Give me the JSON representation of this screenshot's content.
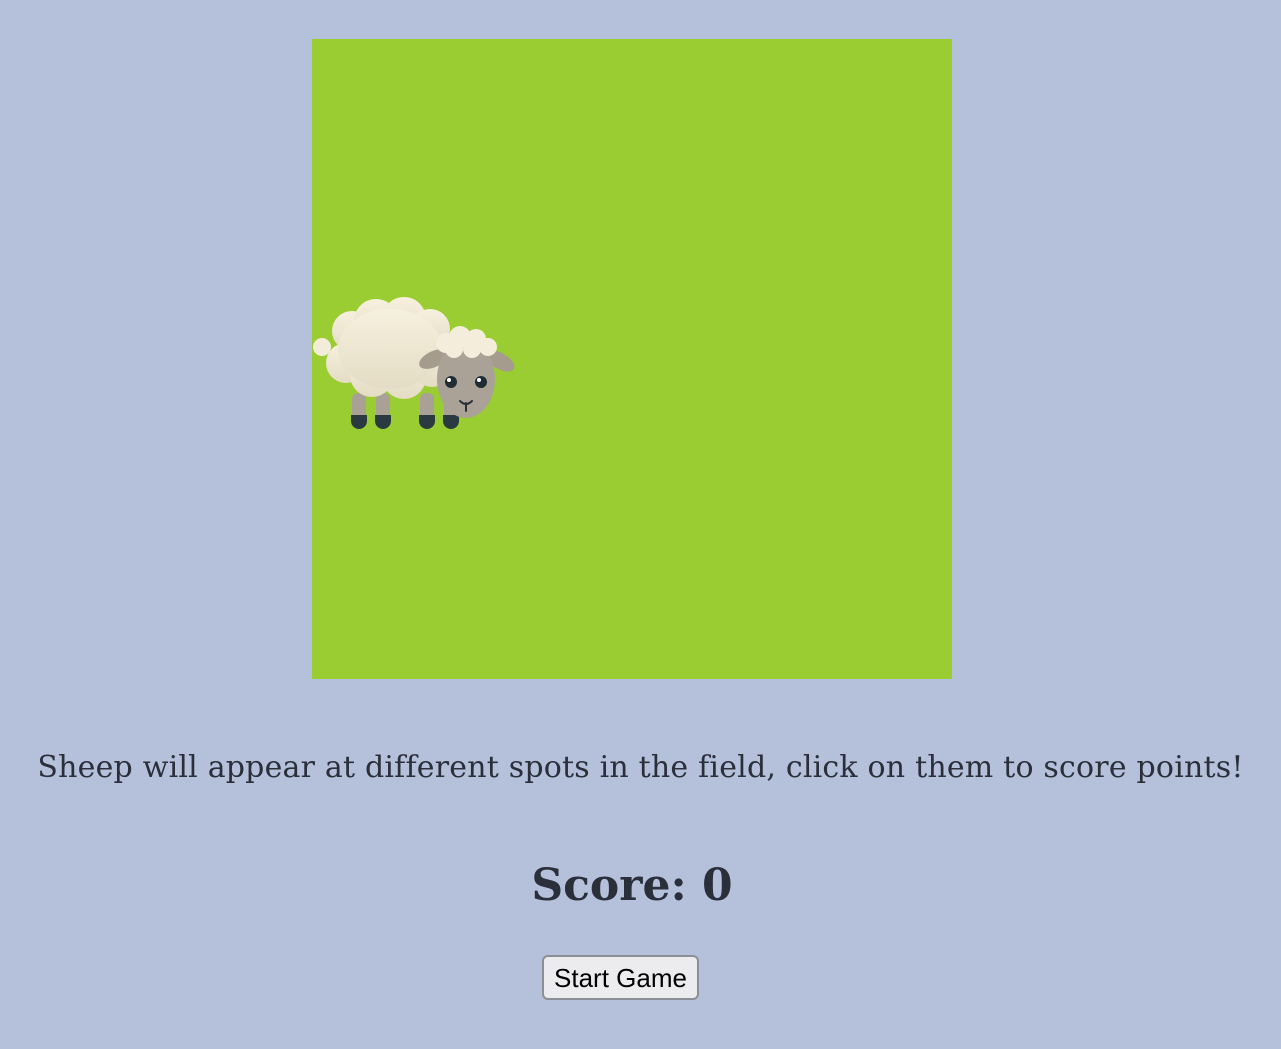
{
  "game": {
    "field_color": "#9acd32",
    "sheep_icon": "sheep-icon"
  },
  "instructions": "Sheep will appear at different spots in the field, click on them to score points!",
  "score_text": "Score: 0",
  "start_button_label": "Start Game",
  "colors": {
    "background": "#b5c1db",
    "text": "#2a2f3a"
  }
}
